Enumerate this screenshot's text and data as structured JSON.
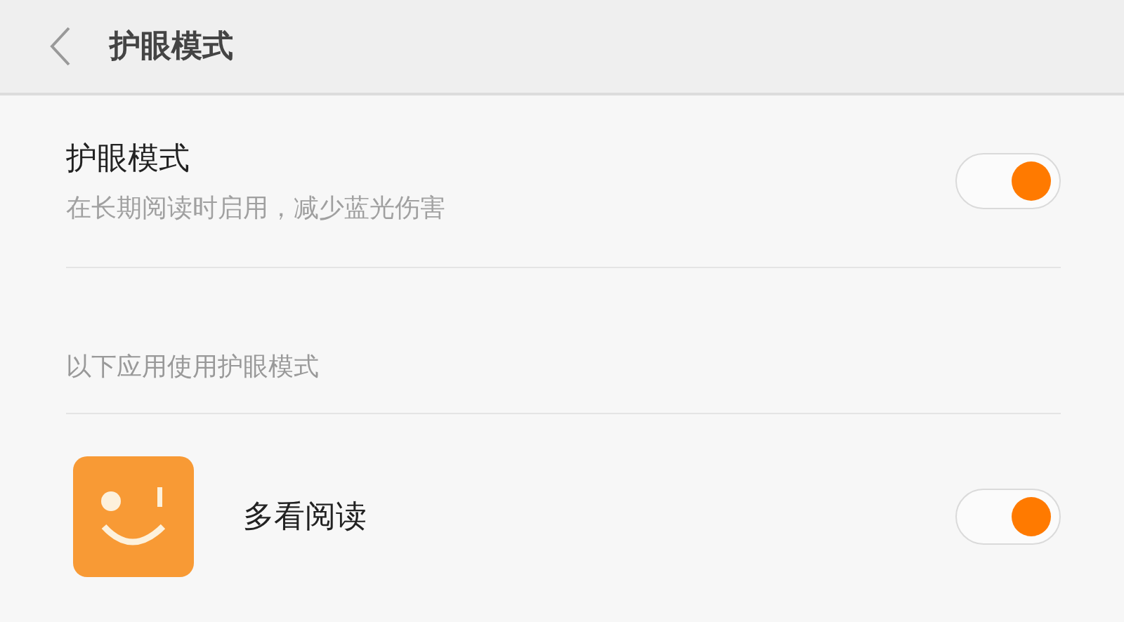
{
  "header": {
    "title": "护眼模式"
  },
  "main_setting": {
    "title": "护眼模式",
    "subtitle": "在长期阅读时启用，减少蓝光伤害",
    "on": true
  },
  "section": {
    "label": "以下应用使用护眼模式"
  },
  "apps": [
    {
      "name": "多看阅读",
      "on": true
    }
  ]
}
